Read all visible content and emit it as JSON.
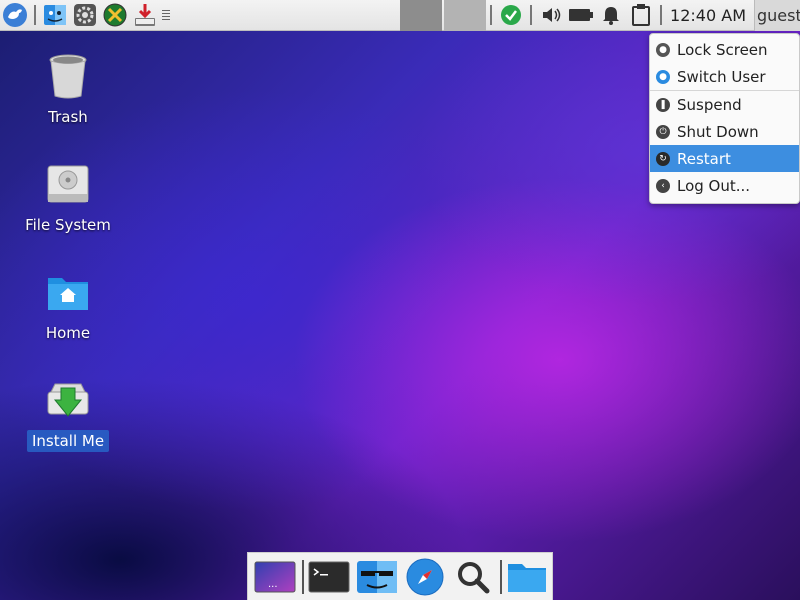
{
  "panel": {
    "launchers": [
      {
        "name": "xfce-menu-icon"
      },
      {
        "name": "file-manager-icon"
      },
      {
        "name": "settings-icon"
      },
      {
        "name": "tools-icon"
      },
      {
        "name": "download-installer-icon"
      }
    ],
    "clock": "12:40 AM",
    "user": "guest"
  },
  "desktop": {
    "icons": [
      {
        "label": "Trash",
        "icon": "trash-icon",
        "selected": false
      },
      {
        "label": "File System",
        "icon": "drive-icon",
        "selected": false
      },
      {
        "label": "Home",
        "icon": "home-folder-icon",
        "selected": false
      },
      {
        "label": "Install Me",
        "icon": "install-icon",
        "selected": true
      }
    ]
  },
  "user_menu": {
    "items": [
      {
        "label": "Lock Screen",
        "icon": "lock-icon"
      },
      {
        "label": "Switch User",
        "icon": "user-icon"
      },
      {
        "label": "Suspend",
        "icon": "suspend-icon"
      },
      {
        "label": "Shut Down",
        "icon": "power-icon"
      },
      {
        "label": "Restart",
        "icon": "restart-icon",
        "active": true
      },
      {
        "label": "Log Out...",
        "icon": "logout-icon"
      }
    ]
  },
  "dock": {
    "items": [
      {
        "name": "show-desktop-icon"
      },
      {
        "name": "terminal-icon"
      },
      {
        "name": "file-manager-icon"
      },
      {
        "name": "web-browser-icon"
      },
      {
        "name": "search-icon"
      },
      {
        "name": "folder-icon"
      }
    ]
  },
  "colors": {
    "accent": "#3d8ee0",
    "panel": "#ececec",
    "selection": "#2864c8"
  }
}
